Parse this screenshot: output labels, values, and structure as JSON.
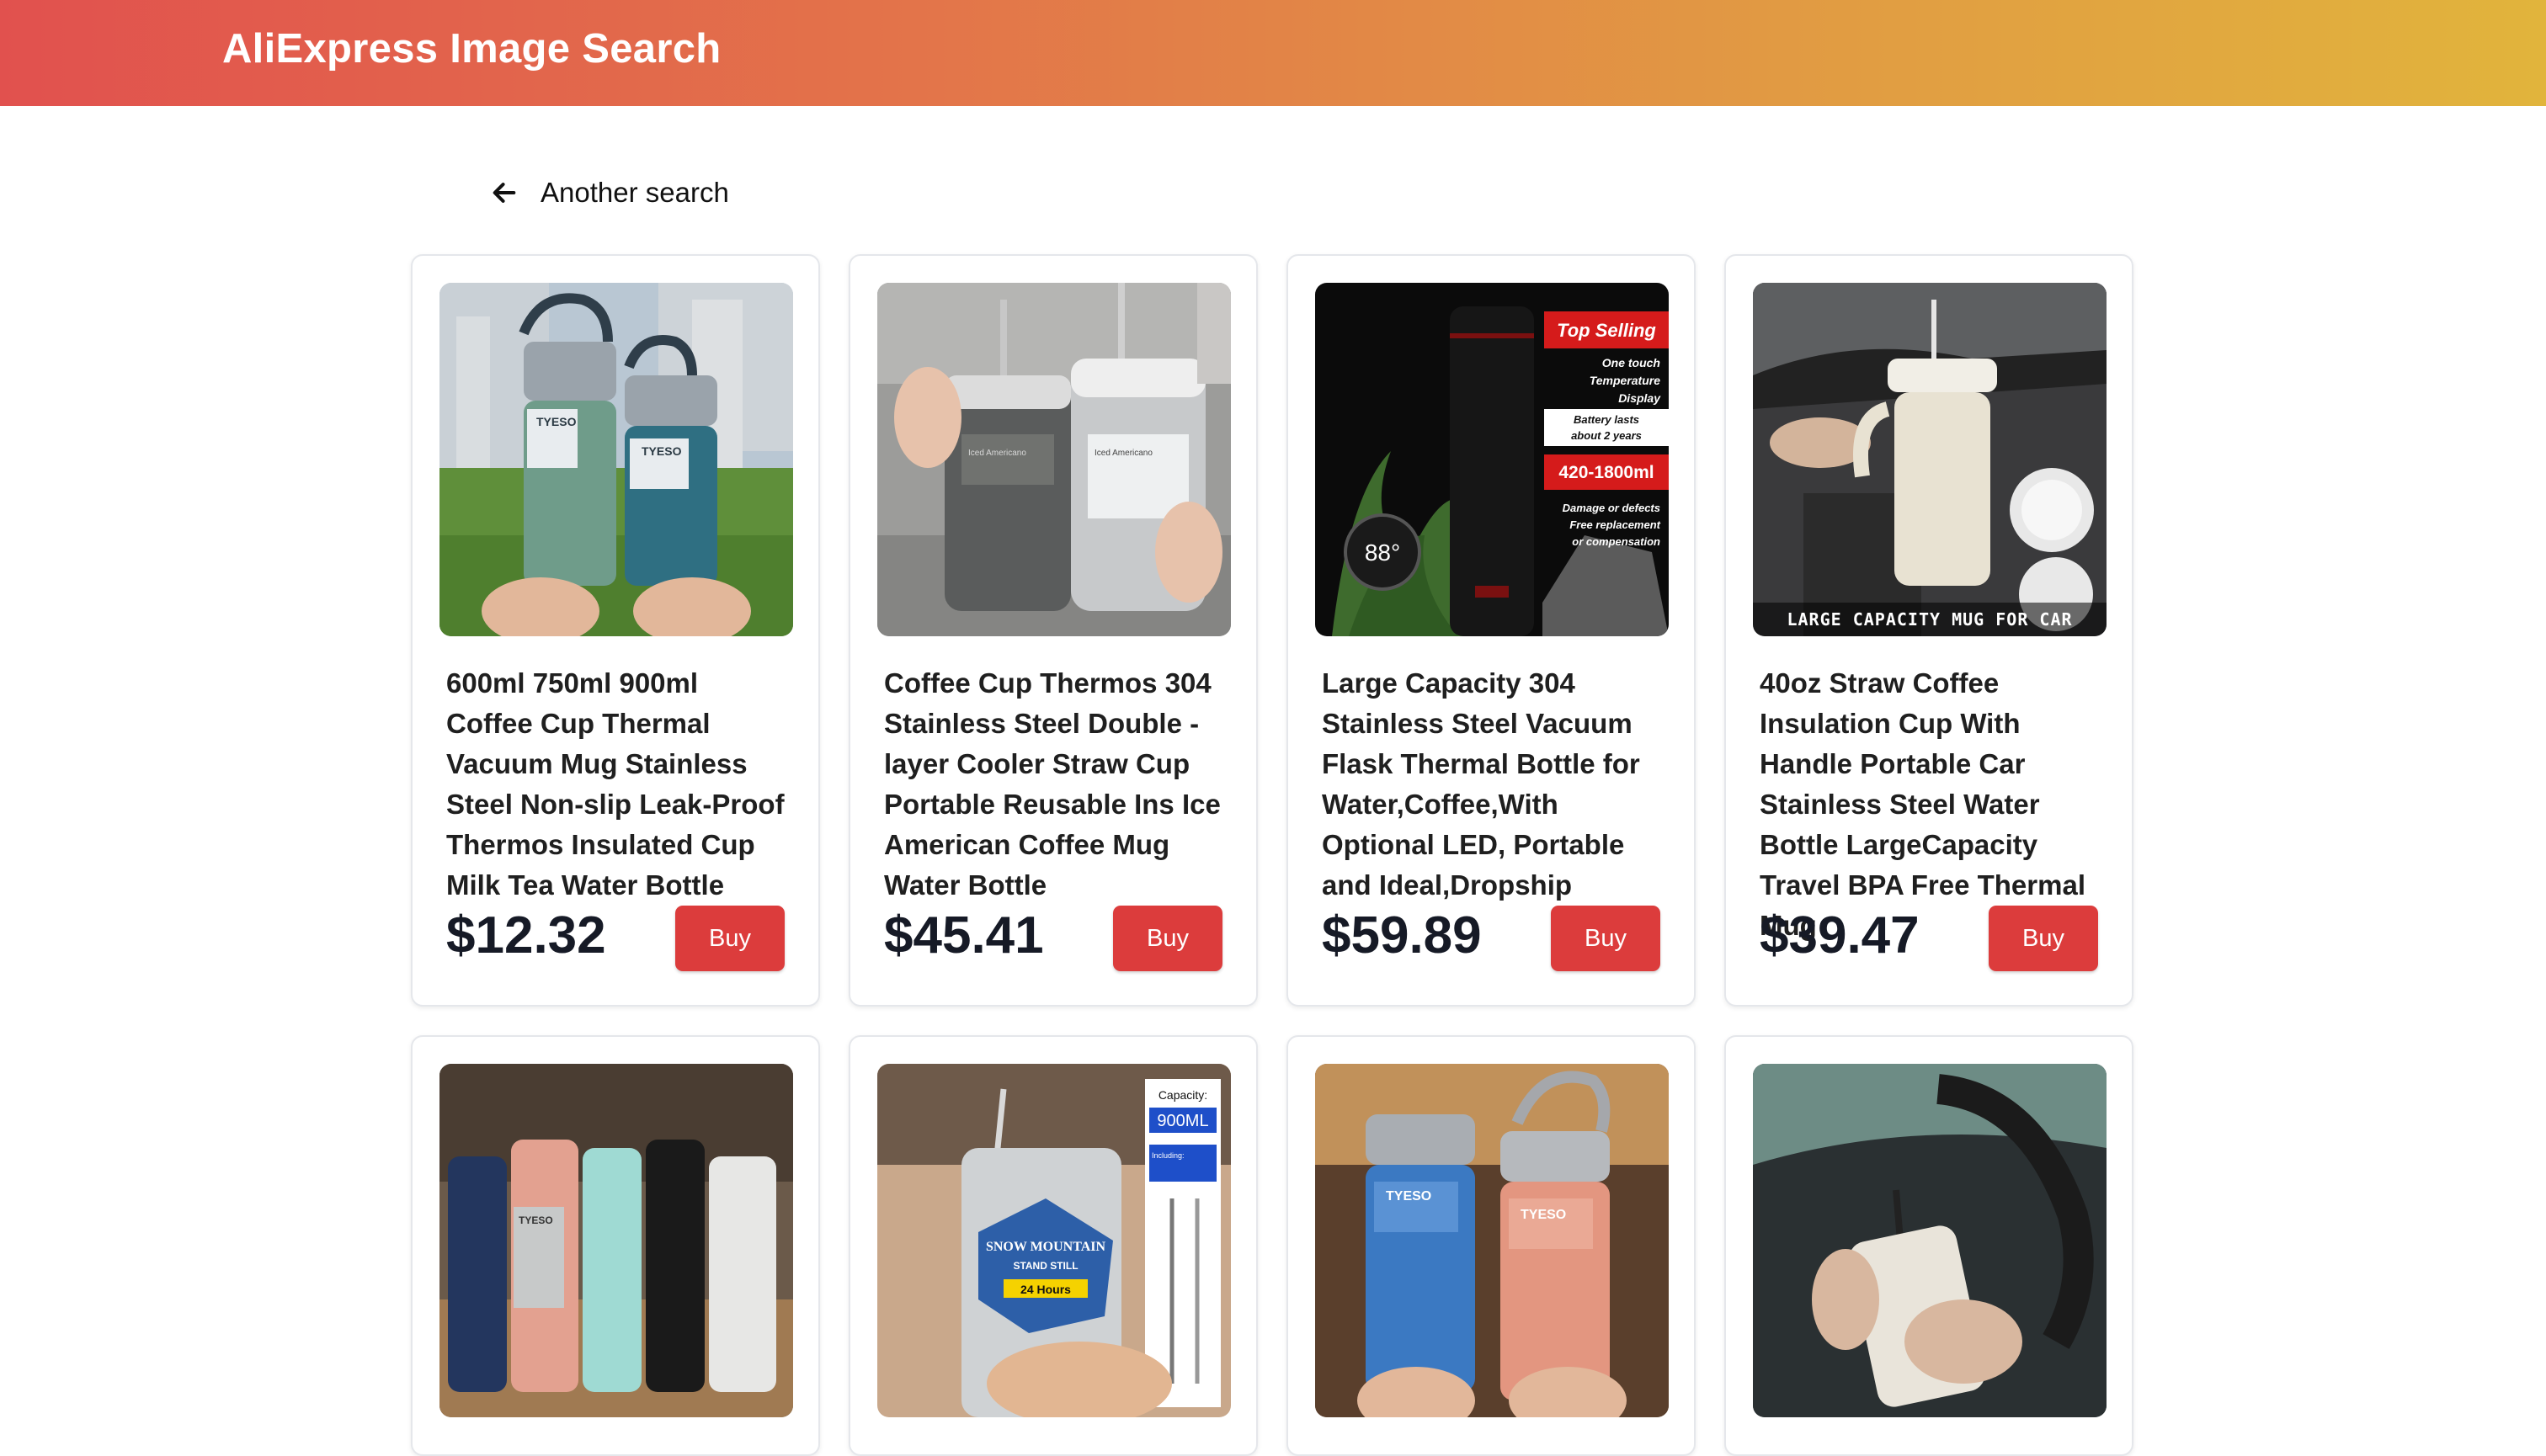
{
  "header": {
    "title": "AliExpress Image Search",
    "gradient_start": "#e1514e",
    "gradient_end": "#e1b43c"
  },
  "nav": {
    "back_icon": "arrow-left-icon",
    "back_label": "Another search"
  },
  "theme": {
    "buy_button_color": "#dc3c3c",
    "price_color": "#161a26"
  },
  "products": [
    {
      "title": "600ml 750ml 900ml Coffee Cup Thermal Vacuum Mug Stainless Steel Non-slip Leak-Proof Thermos Insulated Cup Milk Tea Water Bottle",
      "price": "$12.32",
      "buy_label": "Buy",
      "image": {
        "brand": "TYESO"
      }
    },
    {
      "title": "Coffee Cup Thermos 304 Stainless Steel Double - layer Cooler Straw Cup Portable Reusable Ins Ice American Coffee Mug Water Bottle",
      "price": "$45.41",
      "buy_label": "Buy",
      "image": {
        "brand": "Iced Americano"
      }
    },
    {
      "title": "Large Capacity 304 Stainless Steel Vacuum Flask Thermal Bottle for Water,Coffee,With Optional LED, Portable and Ideal,Dropship",
      "price": "$59.89",
      "buy_label": "Buy",
      "image": {
        "badge_top": "Top Selling",
        "features": [
          "One touch",
          "Temperature",
          "Display",
          "Battery lasts",
          "about 2 years"
        ],
        "capacity": "420-1800ml",
        "notes": [
          "Damage or defects",
          "Free replacement",
          "or compensation"
        ],
        "led_reading": "88°"
      }
    },
    {
      "title": "40oz Straw Coffee Insulation Cup With Handle Portable Car Stainless Steel Water Bottle LargeCapacity Travel BPA Free Thermal Mug",
      "price": "$39.47",
      "buy_label": "Buy",
      "image": {
        "caption": "LARGE CAPACITY MUG FOR CAR"
      }
    },
    {
      "image": {
        "brand": "TYESO"
      }
    },
    {
      "image": {
        "capacity_label": "Capacity:",
        "capacity_value": "900ML",
        "including_note": "Including: stainless steel straw straw brush",
        "brand": "SNOW MOUNTAIN",
        "subtitle": "STAND STILL",
        "hours_banner": "24 Hours"
      }
    },
    {
      "image": {
        "brand": "TYESO"
      }
    },
    {
      "image": {}
    }
  ]
}
